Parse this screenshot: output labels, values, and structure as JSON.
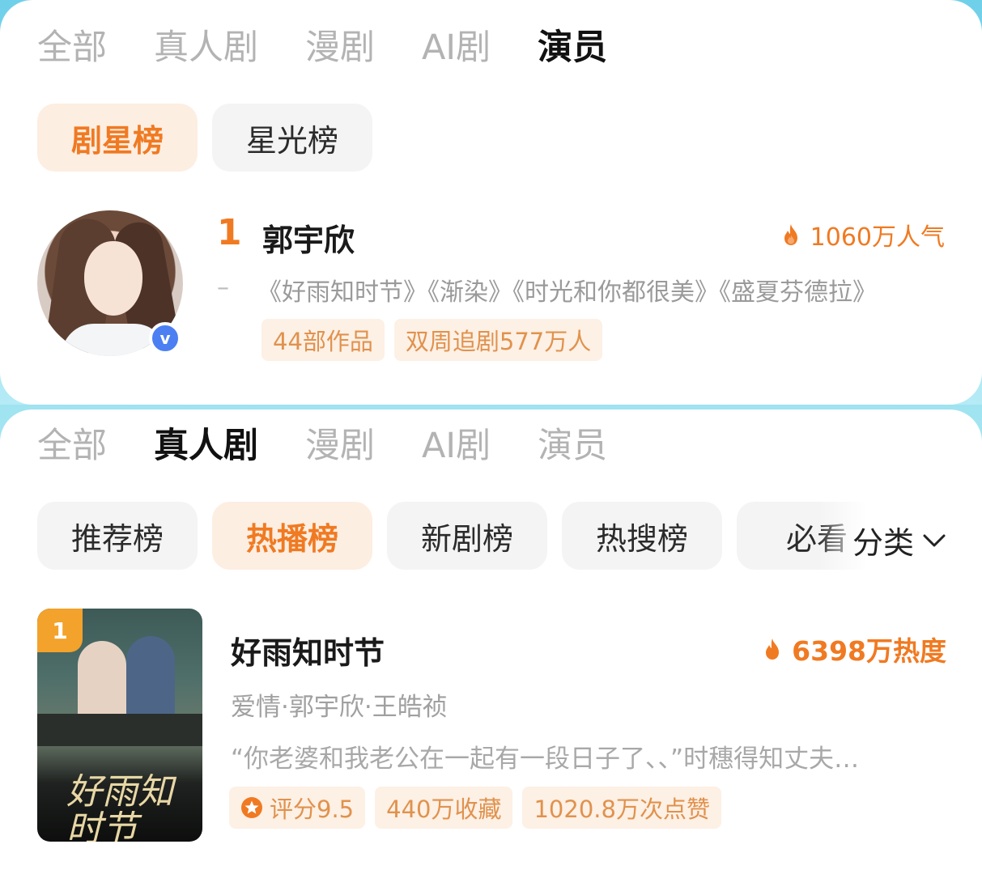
{
  "actor_panel": {
    "tabs": [
      {
        "label": "全部",
        "active": false
      },
      {
        "label": "真人剧",
        "active": false
      },
      {
        "label": "漫剧",
        "active": false
      },
      {
        "label": "AI剧",
        "active": false
      },
      {
        "label": "演员",
        "active": true
      }
    ],
    "pills": [
      {
        "label": "剧星榜",
        "active": true
      },
      {
        "label": "星光榜",
        "active": false
      }
    ],
    "entry": {
      "rank": "1",
      "name": "郭宇欣",
      "verified_badge": "v",
      "heat": "1060万人气",
      "dash": "–",
      "works": "《好雨知时节》《渐染》《时光和你都很美》《盛夏芬德拉》",
      "tags": [
        "44部作品",
        "双周追剧577万人"
      ]
    }
  },
  "drama_panel": {
    "tabs": [
      {
        "label": "全部",
        "active": false
      },
      {
        "label": "真人剧",
        "active": true
      },
      {
        "label": "漫剧",
        "active": false
      },
      {
        "label": "AI剧",
        "active": false
      },
      {
        "label": "演员",
        "active": false
      }
    ],
    "pills": [
      {
        "label": "推荐榜",
        "active": false
      },
      {
        "label": "热播榜",
        "active": true
      },
      {
        "label": "新剧榜",
        "active": false
      },
      {
        "label": "热搜榜",
        "active": false
      },
      {
        "label": "必看",
        "active": false
      }
    ],
    "category": "分类",
    "entry": {
      "rank": "1",
      "title": "好雨知时节",
      "heat": "6398万热度",
      "meta": "爱情·郭宇欣·王皓祯",
      "desc": "“你老婆和我老公在一起有一段日子了、、”时穗得知丈夫…",
      "poster_title": "好雨知时节",
      "rating": "评分9.5",
      "tags": [
        "440万收藏",
        "1020.8万次点赞"
      ]
    }
  },
  "colors": {
    "accent": "#f07a22",
    "tag_bg": "#fdf0e5",
    "tag_text": "#e0924d",
    "verified": "#4c7ff2"
  },
  "icons": [
    "fire-icon",
    "verified-badge-icon",
    "chevron-down-icon",
    "star-badge-icon"
  ]
}
